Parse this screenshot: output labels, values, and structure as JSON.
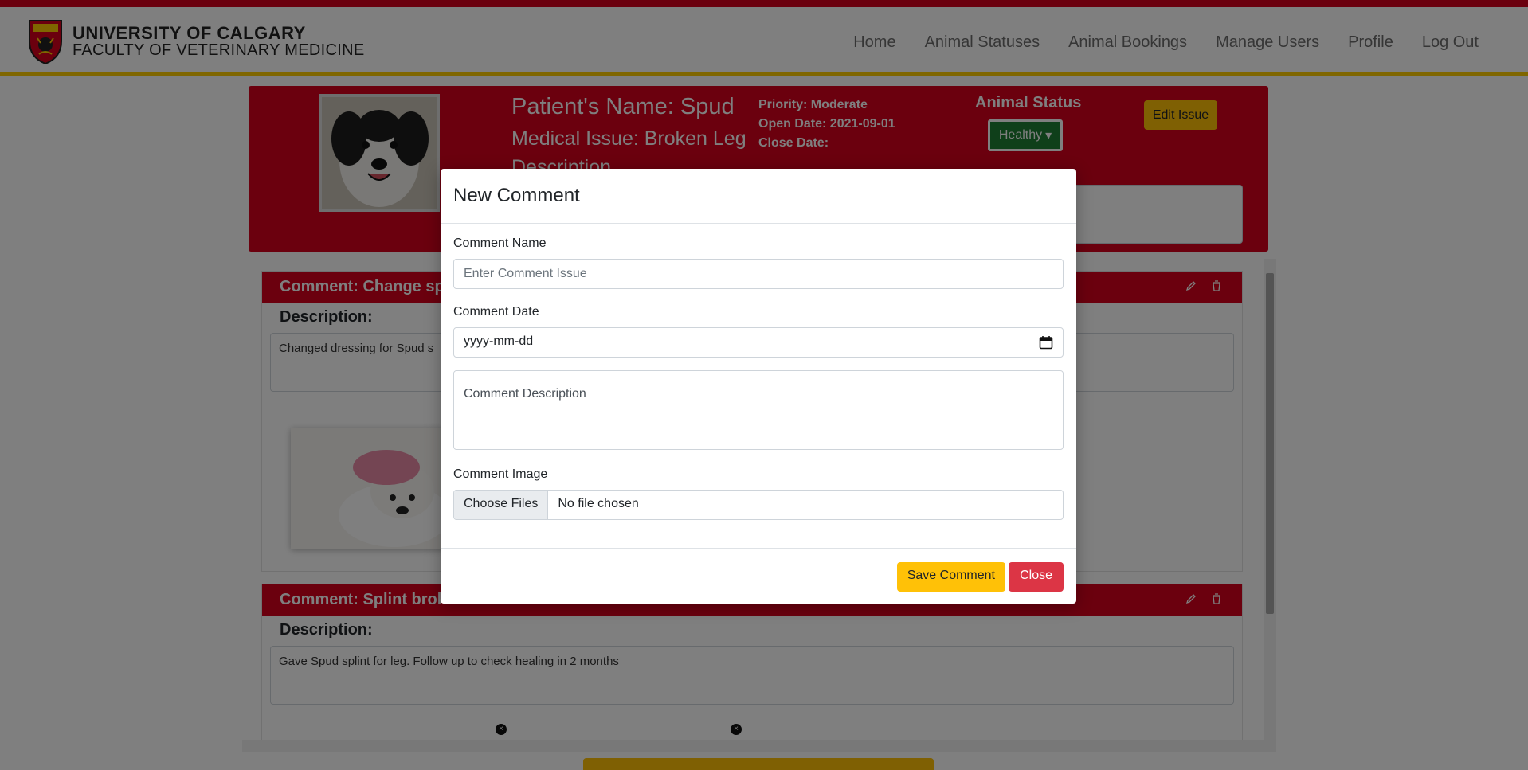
{
  "header": {
    "brand_line1": "UNIVERSITY OF CALGARY",
    "brand_line2": "FACULTY OF VETERINARY MEDICINE",
    "nav": [
      "Home",
      "Animal Statuses",
      "Animal Bookings",
      "Manage Users",
      "Profile",
      "Log Out"
    ]
  },
  "issue": {
    "patient_name": "Patient's Name: Spud",
    "medical_issue": "Medical Issue: Broken Leg",
    "description_label": "Description",
    "priority": "Priority: Moderate",
    "open_date": "Open Date: 2021-09-01",
    "close_date": "Close Date:",
    "status_heading": "Animal Status",
    "status_value": "Healthy",
    "edit_button": "Edit Issue"
  },
  "comments": [
    {
      "title": "Comment: Change spl",
      "description_label": "Description:",
      "description": "Changed dressing for Spud s"
    },
    {
      "title": "Comment: Splint brok",
      "description_label": "Description:",
      "description": "Gave Spud splint for leg. Follow up to check healing in 2 months"
    }
  ],
  "modal": {
    "title": "New Comment",
    "name_label": "Comment Name",
    "name_placeholder": "Enter Comment Issue",
    "date_label": "Comment Date",
    "date_placeholder": "yyyy-mm-dd",
    "description_placeholder": "Comment Description",
    "image_label": "Comment Image",
    "choose_files": "Choose Files",
    "no_file": "No file chosen",
    "save_button": "Save Comment",
    "close_button": "Close"
  },
  "colors": {
    "brand_red": "#d6001c",
    "brand_gold": "#ffcd00",
    "warning": "#ffc107",
    "danger": "#dc3545",
    "success": "#1e7e34"
  }
}
